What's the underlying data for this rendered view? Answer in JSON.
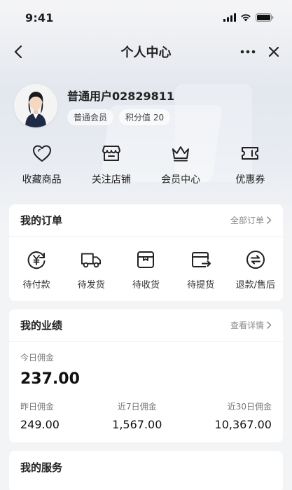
{
  "status_bar": {
    "time": "9:41"
  },
  "nav": {
    "title": "个人中心"
  },
  "profile": {
    "username": "普通用户02829811",
    "member_tag": "普通会员",
    "points_tag": "积分值 20"
  },
  "quick_links": [
    {
      "label": "收藏商品",
      "icon": "heart-icon"
    },
    {
      "label": "关注店铺",
      "icon": "store-icon"
    },
    {
      "label": "会员中心",
      "icon": "crown-icon"
    },
    {
      "label": "优惠券",
      "icon": "coupon-icon"
    }
  ],
  "orders": {
    "title": "我的订单",
    "all_link": "全部订单",
    "items": [
      {
        "label": "待付款",
        "icon": "yen-icon"
      },
      {
        "label": "待发货",
        "icon": "truck-icon"
      },
      {
        "label": "待收货",
        "icon": "box-icon"
      },
      {
        "label": "待提货",
        "icon": "pickup-icon"
      },
      {
        "label": "退款/售后",
        "icon": "refund-icon"
      }
    ]
  },
  "performance": {
    "title": "我的业绩",
    "detail_link": "查看详情",
    "today_label": "今日佣金",
    "today_value": "237.00",
    "yesterday_label": "昨日佣金",
    "yesterday_value": "249.00",
    "week_label": "近7日佣金",
    "week_value": "1,567.00",
    "month_label": "近30日佣金",
    "month_value": "10,367.00"
  },
  "services": {
    "title": "我的服务"
  }
}
